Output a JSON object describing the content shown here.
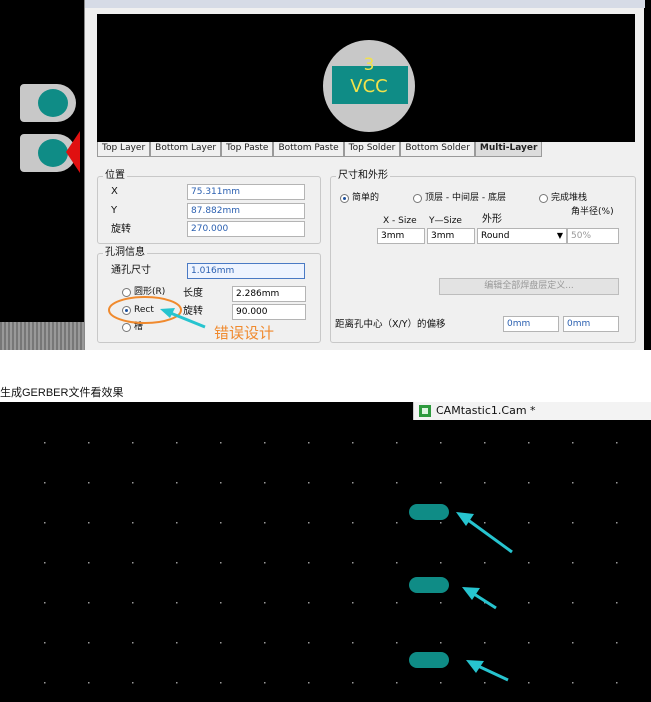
{
  "pad_properties_dialog": {
    "preview": {
      "pad_number": "3",
      "net_name": "VCC"
    },
    "tabs": [
      "Top Layer",
      "Bottom Layer",
      "Top Paste",
      "Bottom Paste",
      "Top Solder",
      "Bottom Solder",
      "Multi-Layer"
    ],
    "active_tab": "Multi-Layer",
    "location": {
      "title": "位置",
      "x_label": "X",
      "x_value": "75.311mm",
      "y_label": "Y",
      "y_value": "87.882mm",
      "rotation_label": "旋转",
      "rotation_value": "270.000"
    },
    "hole_info": {
      "title": "孔洞信息",
      "hole_size_label": "通孔尺寸",
      "hole_size_value": "1.016mm",
      "round_label": "圆形(R)",
      "rect_label": "Rect",
      "slot_label": "槽",
      "selected": "Rect",
      "length_label": "长度",
      "length_value": "2.286mm",
      "rotation_label": "旋转",
      "rotation_value": "90.000"
    },
    "size_shape": {
      "title": "尺寸和外形",
      "mode_simple": "简单的",
      "mode_top_mid_bottom": "顶层 - 中间层 - 底层",
      "mode_full_stack": "完成堆栈",
      "selected_mode": "简单的",
      "x_size_label": "X - Size",
      "y_size_label": "Y—Size",
      "shape_label": "外形",
      "corner_radius_label": "角半径(%)",
      "x_size_value": "3mm",
      "y_size_value": "3mm",
      "shape_value": "Round",
      "corner_radius_value": "50%",
      "edit_stack_button": "编辑全部焊盘层定义...",
      "offset_label": "距离孔中心（X/Y）的偏移",
      "offset_x": "0mm",
      "offset_y": "0mm"
    }
  },
  "annotation": {
    "text": "错误设计",
    "color": "#f08a2e"
  },
  "caption": "生成GERBER文件看效果",
  "camtastic": {
    "tab_title": "CAMtastic1.Cam *"
  },
  "colors": {
    "pad_copper": "#0f8c86",
    "pad_body": "#c8c8c8",
    "label_yellow": "#f2e24a",
    "arrow_cyan": "#27c4cf",
    "highlight_orange": "#f08a2e"
  }
}
